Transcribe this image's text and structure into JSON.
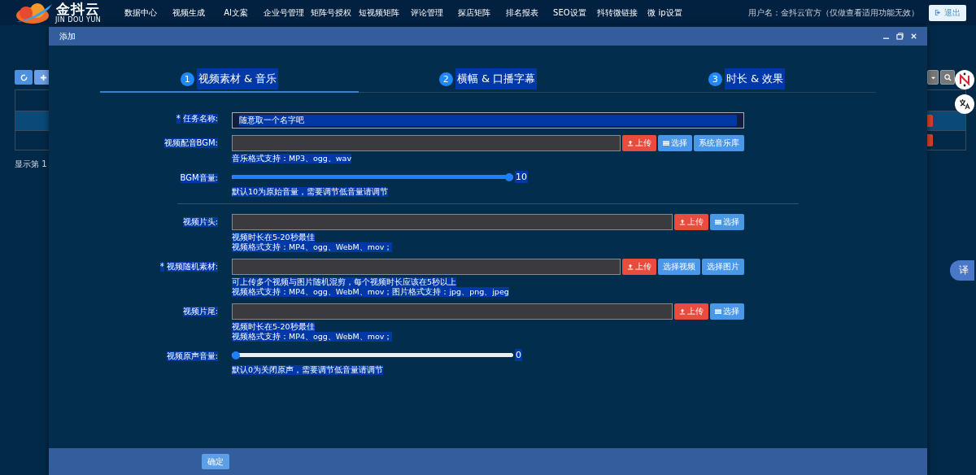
{
  "logo": {
    "name": "金抖云",
    "subtitle": "JIN DOU YUN"
  },
  "nav": [
    {
      "label": "数据中心"
    },
    {
      "label": "视频生成"
    },
    {
      "label": "AI文案"
    },
    {
      "label": "企业号管理"
    },
    {
      "label": "矩阵号授权"
    },
    {
      "label": "短视频矩阵"
    },
    {
      "label": "评论管理"
    },
    {
      "label": "探店矩阵"
    },
    {
      "label": "排名报表"
    },
    {
      "label": "SEO设置"
    },
    {
      "label": "抖转微链接"
    },
    {
      "label": "微 ip设置"
    }
  ],
  "user": "用户名：金抖云官方（仅做查看适用功能无效）",
  "logout": "退出",
  "background_page": {
    "summary": "显示第 1",
    "rows": [
      {
        "selected": true
      },
      {
        "selected": false
      }
    ]
  },
  "modal": {
    "title": "添加",
    "steps": [
      {
        "number": "1",
        "label": "视频素材 & 音乐",
        "selected": true
      },
      {
        "number": "2",
        "label": "横幅 & 口播字幕",
        "selected": false
      },
      {
        "number": "3",
        "label": "时长 & 效果",
        "selected": false
      }
    ],
    "fields": [
      {
        "kind": "text",
        "label": "任务名称:",
        "required_mark": "*",
        "placeholder": "随意取一个名字吧"
      },
      {
        "kind": "file",
        "label": "视频配音BGM:",
        "buttons": [
          {
            "kind": "upload",
            "label": "上传"
          },
          {
            "kind": "list",
            "label": "选择"
          },
          {
            "kind": "plain",
            "label": "系统音乐库"
          }
        ],
        "hints": [
          "音乐格式支持：MP3、ogg、wav"
        ]
      },
      {
        "kind": "slider",
        "label": "BGM音量:",
        "level": 1,
        "reading": "10",
        "hints": [
          "默认10为原始音量，需要调节低音量请调节"
        ]
      },
      {
        "kind": "divider"
      },
      {
        "kind": "file",
        "label": "视频片头:",
        "buttons": [
          {
            "kind": "upload",
            "label": "上传"
          },
          {
            "kind": "list",
            "label": "选择"
          }
        ],
        "hints": [
          "视频时长在5-20秒最佳",
          "视频格式支持：MP4、ogg、WebM、mov；"
        ]
      },
      {
        "kind": "file",
        "label": "视频随机素材:",
        "required_mark": "*",
        "buttons": [
          {
            "kind": "upload",
            "label": "上传"
          },
          {
            "kind": "plain",
            "label": "选择视频"
          },
          {
            "kind": "plain",
            "label": "选择图片"
          }
        ],
        "hints": [
          "可上传多个视频与图片随机混剪，每个视频时长应该在5秒以上",
          "视频格式支持：MP4、ogg、WebM、mov；图片格式支持：jpg、png、jpeg"
        ]
      },
      {
        "kind": "file",
        "label": "视频片尾:",
        "buttons": [
          {
            "kind": "upload",
            "label": "上传"
          },
          {
            "kind": "list",
            "label": "选择"
          }
        ],
        "hints": [
          "视频时长在5-20秒最佳",
          "视频格式支持：MP4、ogg、WebM、mov；"
        ]
      },
      {
        "kind": "slider",
        "label": "视频原声音量:",
        "level": 0,
        "reading": "0",
        "hints": [
          "默认0为关闭原声，需要调节低音量请调节"
        ]
      }
    ],
    "confirm": "确定"
  },
  "side_tools": {
    "translate_label": "译"
  }
}
